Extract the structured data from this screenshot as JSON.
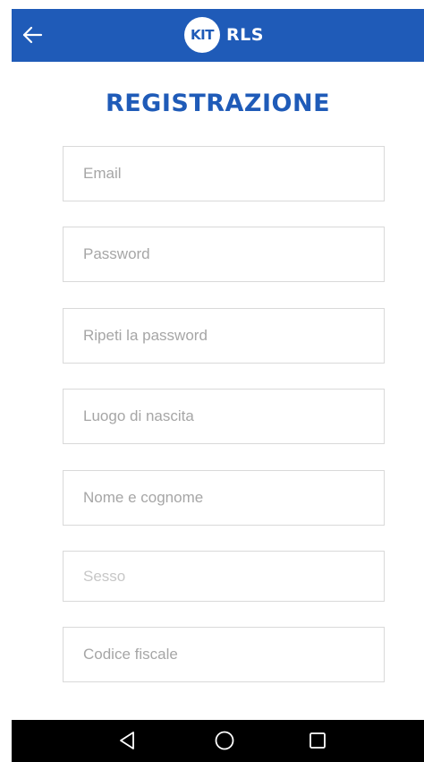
{
  "appbar": {
    "logo_badge": "KIT",
    "logo_text": "RLS",
    "color": "#1f5bb8"
  },
  "page": {
    "title": "REGISTRAZIONE"
  },
  "form": {
    "fields": [
      {
        "placeholder": "Email"
      },
      {
        "placeholder": "Password"
      },
      {
        "placeholder": "Ripeti la password"
      },
      {
        "placeholder": "Luogo di nascita"
      },
      {
        "placeholder": "Nome e cognome"
      },
      {
        "placeholder": "Sesso"
      },
      {
        "placeholder": "Codice fiscale"
      }
    ]
  },
  "system_nav": {
    "icons": [
      "back-triangle-icon",
      "home-circle-icon",
      "recents-square-icon"
    ]
  }
}
